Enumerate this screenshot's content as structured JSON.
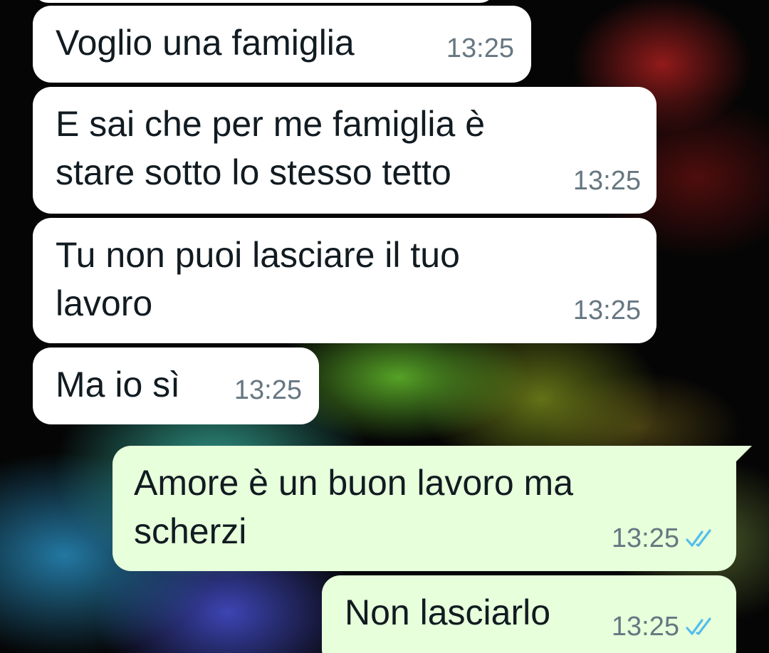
{
  "messages": [
    {
      "direction": "in",
      "text": "Voglio una famiglia",
      "time": "13:25"
    },
    {
      "direction": "in",
      "text": "E sai che per me famiglia è\nstare sotto lo stesso tetto",
      "time": "13:25"
    },
    {
      "direction": "in",
      "text": "Tu non puoi lasciare il tuo\nlavoro",
      "time": "13:25"
    },
    {
      "direction": "in",
      "text": "Ma io sì",
      "time": "13:25"
    },
    {
      "direction": "out",
      "text": "Amore è un buon lavoro ma\nscherzi",
      "time": "13:25",
      "status_icon": "double-check-icon"
    },
    {
      "direction": "out",
      "text": "Non lasciarlo",
      "time": "13:25",
      "status_icon": "double-check-icon"
    }
  ],
  "colors": {
    "incoming_bubble": "#ffffff",
    "outgoing_bubble": "#e7ffdb",
    "read_ticks": "#53bdeb",
    "timestamp": "#667781"
  }
}
